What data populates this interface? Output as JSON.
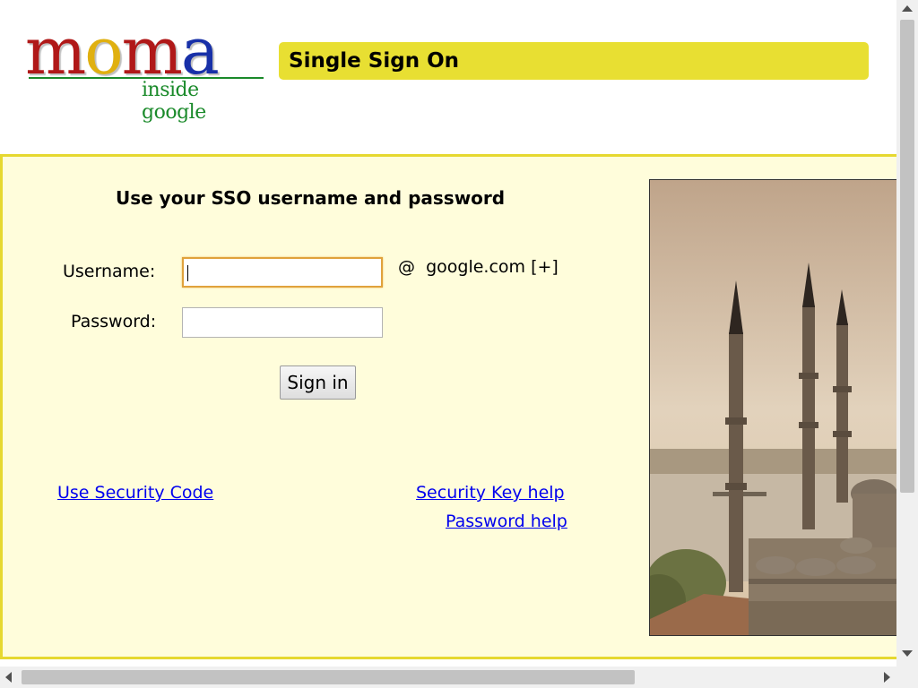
{
  "header": {
    "logo_text": "moma",
    "logo_sub": "inside google",
    "title": "Single Sign On"
  },
  "form": {
    "heading": "Use your SSO username and password",
    "username_label": "Username:",
    "username_value": "",
    "domain_at": "@",
    "domain_text": "google.com [+]",
    "password_label": "Password:",
    "password_value": "",
    "signin_label": "Sign in"
  },
  "links": {
    "security_code": "Use Security Code",
    "security_key_help": "Security Key help",
    "password_help": "Password help"
  },
  "colors": {
    "title_bar": "#e8df32",
    "panel_bg": "#fffddb",
    "panel_border": "#e6d830",
    "link": "#0000ee",
    "logo_m1": "#b01818",
    "logo_o1": "#e0b010",
    "logo_m2": "#b01818",
    "logo_a": "#1830a8",
    "logo_sub": "#1a8a2a"
  },
  "photo": {
    "icon": "mosque-minarets-photo"
  }
}
